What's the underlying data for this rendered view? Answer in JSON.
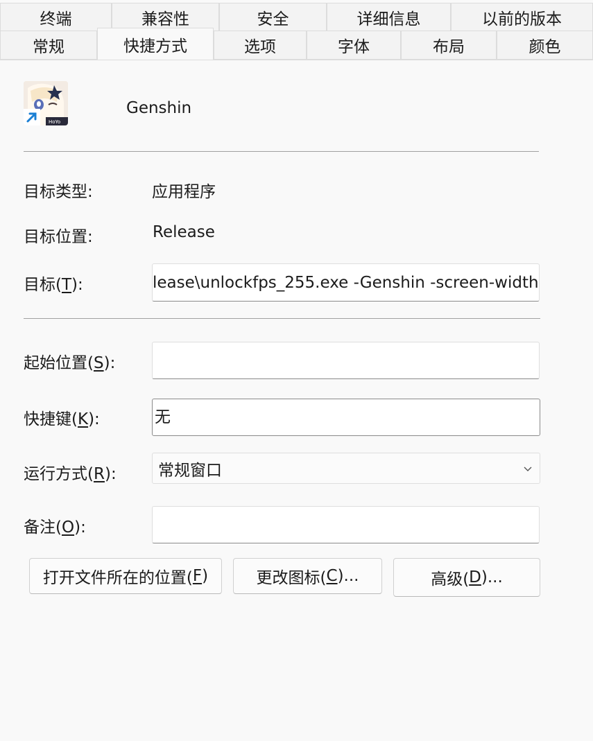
{
  "tabs_row1": [
    "终端",
    "兼容性",
    "安全",
    "详细信息",
    "以前的版本"
  ],
  "tabs_row2": [
    "常规",
    "快捷方式",
    "选项",
    "字体",
    "布局",
    "颜色"
  ],
  "active_tab": "快捷方式",
  "shortcut": {
    "name": "Genshin",
    "icon_text": "HoYo"
  },
  "target_type": {
    "label": "目标类型:",
    "value": "应用程序"
  },
  "target_location": {
    "label": "目标位置:",
    "value": "Release"
  },
  "target": {
    "label_pre": "目标(",
    "label_key": "T",
    "label_post": "):",
    "value": "lease\\unlockfps_255.exe -Genshin -screen-width"
  },
  "start_in": {
    "label_pre": "起始位置(",
    "label_key": "S",
    "label_post": "):",
    "value": ""
  },
  "shortcut_key": {
    "label_pre": "快捷键(",
    "label_key": "K",
    "label_post": "):",
    "value": "无"
  },
  "run": {
    "label_pre": "运行方式(",
    "label_key": "R",
    "label_post": "):",
    "value": "常规窗口"
  },
  "comment": {
    "label_pre": "备注(",
    "label_key": "O",
    "label_post": "):",
    "value": ""
  },
  "buttons": {
    "open_location": {
      "pre": "打开文件所在的位置(",
      "key": "F",
      "post": ")"
    },
    "change_icon": {
      "pre": "更改图标(",
      "key": "C",
      "post": ")..."
    },
    "advanced": {
      "pre": "高级(",
      "key": "D",
      "post": ")..."
    }
  }
}
